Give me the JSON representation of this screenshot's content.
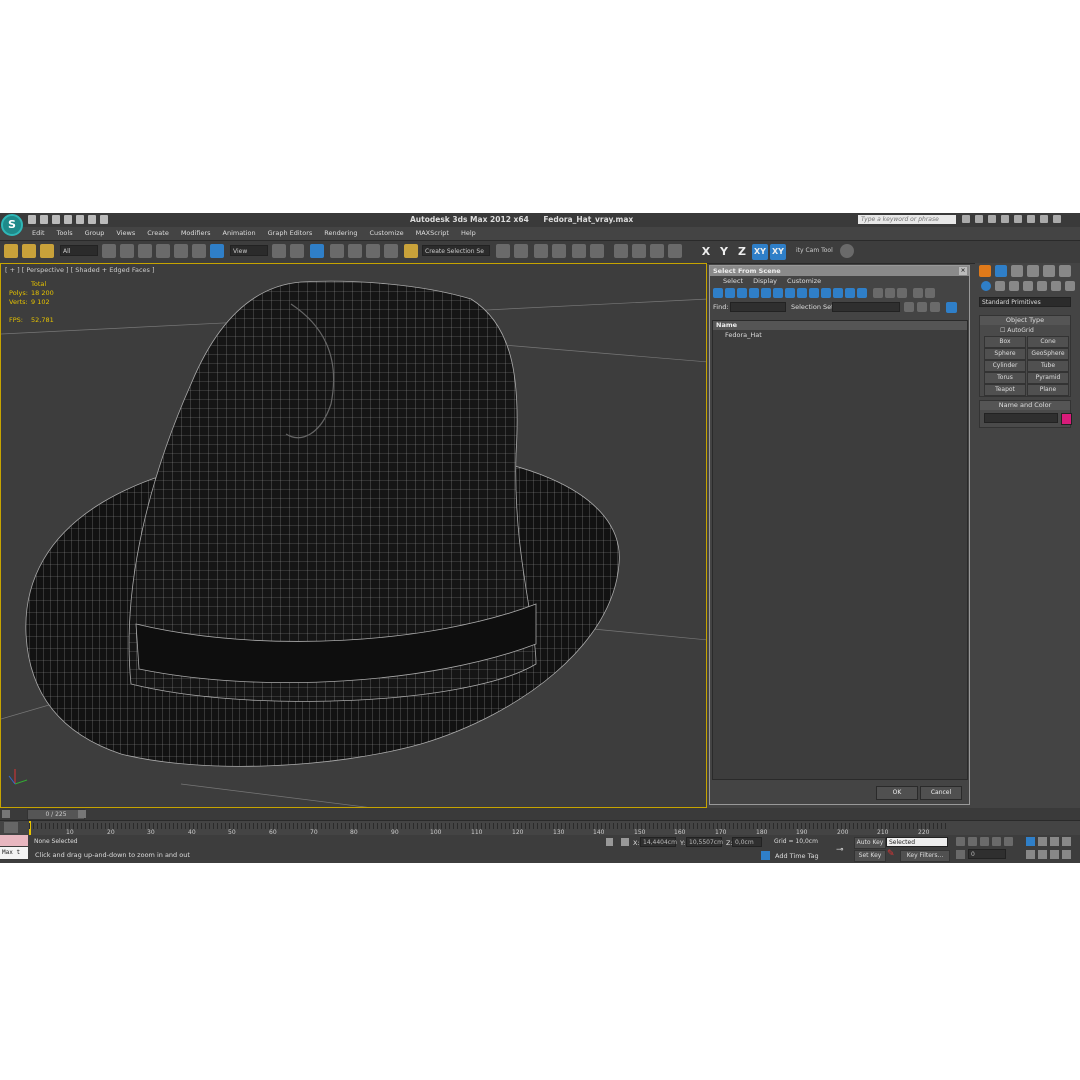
{
  "window": {
    "app_title": "Autodesk 3ds Max  2012 x64",
    "file_title": "Fedora_Hat_vray.max",
    "search_placeholder": "Type a keyword or phrase"
  },
  "menu": [
    "Edit",
    "Tools",
    "Group",
    "Views",
    "Create",
    "Modifiers",
    "Animation",
    "Graph Editors",
    "Rendering",
    "Customize",
    "MAXScript",
    "Help"
  ],
  "toolbar": {
    "selection_filter": "All",
    "ref_coord": "View",
    "selection_set": "Create Selection Se",
    "axis_x": "X",
    "axis_y": "Y",
    "axis_z": "Z",
    "axis_xy": "XY",
    "axis_xy2": "XY",
    "cam_tool": "ity Cam Tool"
  },
  "viewport": {
    "label": "[ + ] [ Perspective ] [ Shaded + Edged Faces ]",
    "stats_header": "Total",
    "polys_label": "Polys:",
    "polys_value": "18 200",
    "verts_label": "Verts:",
    "verts_value": "9 102",
    "fps_label": "FPS:",
    "fps_value": "52,781"
  },
  "dialog": {
    "title": "Select From Scene",
    "menu": [
      "Select",
      "Display",
      "Customize"
    ],
    "find_label": "Find:",
    "selset_label": "Selection Set:",
    "column_name": "Name",
    "items": [
      "Fedora_Hat"
    ],
    "ok": "OK",
    "cancel": "Cancel"
  },
  "command_panel": {
    "category": "Standard Primitives",
    "object_type_header": "Object Type",
    "autogrid": "AutoGrid",
    "buttons": [
      "Box",
      "Cone",
      "Sphere",
      "GeoSphere",
      "Cylinder",
      "Tube",
      "Torus",
      "Pyramid",
      "Teapot",
      "Plane"
    ],
    "name_color_header": "Name and Color",
    "object_color": "#d81b7a"
  },
  "timeline": {
    "slider": "0 / 225",
    "ticks": [
      "10",
      "20",
      "30",
      "40",
      "50",
      "60",
      "70",
      "80",
      "90",
      "100",
      "110",
      "120",
      "130",
      "140",
      "150",
      "160",
      "170",
      "180",
      "190",
      "200",
      "210",
      "220"
    ]
  },
  "status": {
    "selection": "None Selected",
    "prompt": "Click and drag up-and-down to zoom in and out",
    "x_label": "X:",
    "x_value": "14,4404cm",
    "y_label": "Y:",
    "y_value": "10,5507cm",
    "z_label": "Z:",
    "z_value": "0,0cm",
    "grid": "Grid = 10,0cm",
    "add_time_tag": "Add Time Tag",
    "auto_key": "Auto Key",
    "selected_dd": "Selected",
    "set_key": "Set Key",
    "key_filters": "Key Filters...",
    "frame": "0",
    "maxscript": "Max t"
  },
  "colors": {
    "viewport_border": "#c6a400",
    "accent_blue": "#2f7fc8",
    "stats_yellow": "#e6c300"
  }
}
